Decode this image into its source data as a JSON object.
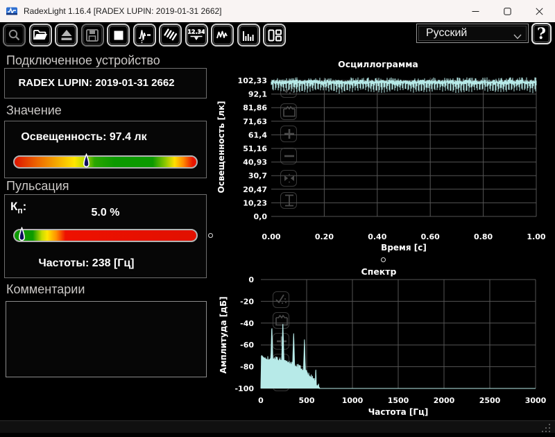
{
  "window": {
    "title": "RadexLight 1.16.4 [RADEX LUPIN: 2019-01-31 2662]"
  },
  "toolbar": {
    "buttons": [
      {
        "name": "zoom-window",
        "icon": "magnifier",
        "enabled": false
      },
      {
        "name": "open-file",
        "icon": "open-folder",
        "enabled": true
      },
      {
        "name": "eject-device",
        "icon": "eject",
        "enabled": true
      },
      {
        "name": "save-file",
        "icon": "floppy",
        "enabled": false
      },
      {
        "name": "stop-measurement",
        "icon": "stop",
        "enabled": true
      },
      {
        "name": "record-trace",
        "icon": "record-trace",
        "enabled": true
      },
      {
        "name": "spectrogram-view",
        "icon": "hatch-lines",
        "enabled": true
      },
      {
        "name": "measurement-view",
        "icon": "measure-12-34",
        "enabled": true
      },
      {
        "name": "oscillogram-view",
        "icon": "wave",
        "enabled": true
      },
      {
        "name": "spectrum-view",
        "icon": "histogram-bars",
        "enabled": true
      },
      {
        "name": "layout-panels",
        "icon": "layout",
        "enabled": true
      }
    ],
    "language_value": "Русский",
    "help_label": "?"
  },
  "device": {
    "section_label": "Подключенное устройство",
    "name": "RADEX LUPIN: 2019-01-31 2662"
  },
  "value_section": {
    "section_label": "Значение",
    "reading": "Освещенность: 97.4 лк",
    "marker_fraction": 0.395
  },
  "pulsation": {
    "section_label": "Пульсация",
    "kp_base": "К",
    "kp_sub": "п",
    "kp_colon": ":",
    "kp_value": "5.0 %",
    "marker_fraction": 0.045,
    "frequency": "Частоты: 238 [Гц]"
  },
  "comments": {
    "section_label": "Комментарии",
    "value": ""
  },
  "chart_tools": [
    "select-region",
    "fit-window",
    "zoom-in",
    "zoom-out",
    "fit-all",
    "fit-vertical"
  ],
  "chart_data": [
    {
      "id": "oscillogram",
      "type": "line",
      "title": "Осциллограмма",
      "xlabel": "Время [с]",
      "ylabel": "Освещенность [лк]",
      "yticks": [
        "102,33",
        "92,1",
        "81,86",
        "71,63",
        "61,4",
        "51,16",
        "40,93",
        "30,7",
        "20,47",
        "10,23",
        "0,0"
      ],
      "xticks": [
        "0.00",
        "0.20",
        "0.40",
        "0.60",
        "0.80",
        "1.00"
      ],
      "ylim": [
        0,
        102.33
      ],
      "xlim": [
        0,
        1
      ],
      "signal": {
        "kind": "flicker-waveform",
        "mean_lux": 97.4,
        "min_lux": 92.5,
        "max_lux": 102.4,
        "frequency_hz": 100,
        "modulation_percent": 5.0
      },
      "line_color": "#b7eae8",
      "grid_color": "#555555"
    },
    {
      "id": "spectrum",
      "type": "area",
      "title": "Спектр",
      "xlabel": "Частота [Гц]",
      "ylabel": "Амплитуда [дБ]",
      "yticks": [
        "0",
        "-20",
        "-40",
        "-60",
        "-80",
        "-100"
      ],
      "xticks": [
        "0",
        "500",
        "1000",
        "1500",
        "2000",
        "2500",
        "3000"
      ],
      "ylim": [
        -100,
        0
      ],
      "xlim": [
        0,
        3000
      ],
      "noise_floor_db": [
        [
          0,
          -100
        ],
        [
          6,
          -70
        ],
        [
          25,
          -72
        ],
        [
          60,
          -74
        ],
        [
          120,
          -73
        ],
        [
          180,
          -75
        ],
        [
          240,
          -74
        ],
        [
          300,
          -76
        ],
        [
          360,
          -79
        ],
        [
          420,
          -82
        ],
        [
          470,
          -84
        ],
        [
          520,
          -88
        ],
        [
          560,
          -91
        ],
        [
          600,
          -94
        ],
        [
          620,
          -100
        ],
        [
          3000,
          -100
        ]
      ],
      "peaks_db": [
        [
          120,
          -42
        ],
        [
          240,
          -38
        ],
        [
          358,
          -48
        ],
        [
          476,
          -55
        ],
        [
          600,
          -80
        ]
      ],
      "fill_color": "#b7eae8",
      "grid_color": "#555555"
    }
  ]
}
